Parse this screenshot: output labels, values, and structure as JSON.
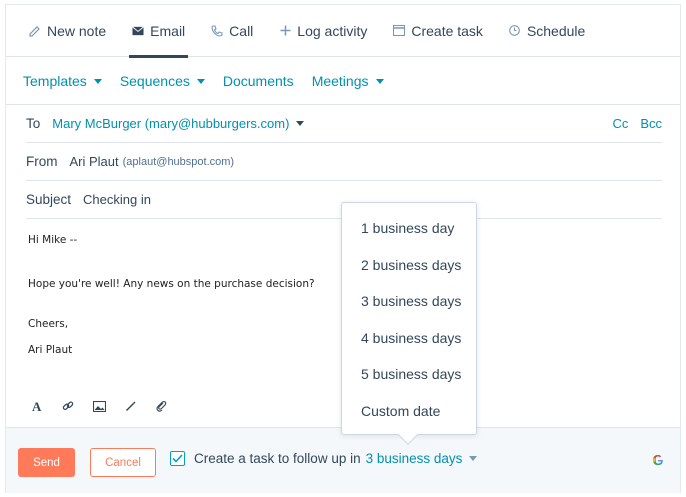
{
  "tabs": [
    {
      "label": "New note",
      "icon": "pencil-icon"
    },
    {
      "label": "Email",
      "icon": "envelope-icon"
    },
    {
      "label": "Call",
      "icon": "phone-icon"
    },
    {
      "label": "Log activity",
      "icon": "plus-icon"
    },
    {
      "label": "Create task",
      "icon": "task-icon"
    },
    {
      "label": "Schedule",
      "icon": "clock-icon"
    }
  ],
  "toolbar": {
    "templates": "Templates",
    "sequences": "Sequences",
    "documents": "Documents",
    "meetings": "Meetings"
  },
  "to": {
    "label": "To",
    "value": "Mary McBurger (mary@hubburgers.com)",
    "cc": "Cc",
    "bcc": "Bcc"
  },
  "from": {
    "label": "From",
    "name": "Ari Plaut",
    "email": "(aplaut@hubspot.com)"
  },
  "subject": {
    "label": "Subject",
    "value": "Checking in"
  },
  "body": {
    "greeting": "Hi Mike --",
    "line1": "Hope you're well! Any news on the purchase decision?",
    "signoff": "Cheers,",
    "signature": "Ari Plaut"
  },
  "footer": {
    "send": "Send",
    "cancel": "Cancel",
    "task_text": "Create a task to follow up in",
    "task_value": "3 business days",
    "task_checked": true
  },
  "dropdown": {
    "options": [
      "1 business day",
      "2 business days",
      "3 business days",
      "4 business days",
      "5 business days",
      "Custom date"
    ]
  },
  "colors": {
    "accent": "#0091ae",
    "send": "#ff7a59",
    "text": "#33475b"
  }
}
